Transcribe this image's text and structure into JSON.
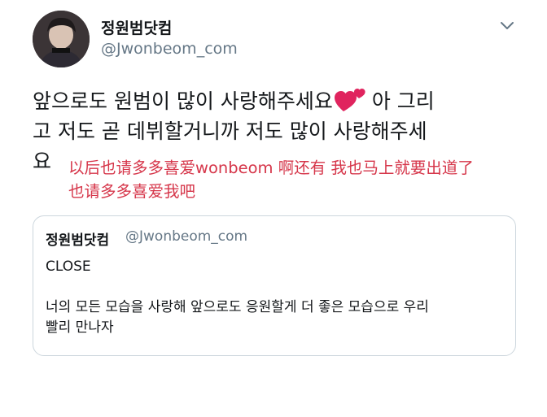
{
  "tweet": {
    "author": {
      "display_name": "정원범닷컴",
      "handle": "@Jwonbeom_com",
      "avatar_icon": "profile-photo"
    },
    "menu_icon": "chevron-down-icon",
    "text_lines": [
      "앞으로도 원범이 많이 사랑해주세요",
      "아 그리",
      "고 저도 곧 데뷔할거니까 저도 많이 사랑해주세",
      "요"
    ],
    "emoji": "two-hearts-icon",
    "translation_lines": [
      "以后也请多多喜爱wonbeom 啊还有 我也马上就要出道了",
      "也请多多喜爱我吧"
    ],
    "translation_color": "#d6364a"
  },
  "quoted_tweet": {
    "author": {
      "display_name": "정원범닷컴",
      "handle": "@Jwonbeom_com"
    },
    "title": "CLOSE",
    "body_lines": [
      "너의 모든 모습을 사랑해 앞으로도 응원할게 더 좋은 모습으로 우리",
      "빨리 만나자"
    ]
  },
  "colors": {
    "text": "#14171a",
    "secondary": "#657786",
    "border": "#ccd6dd",
    "heart": "#e0245e"
  }
}
